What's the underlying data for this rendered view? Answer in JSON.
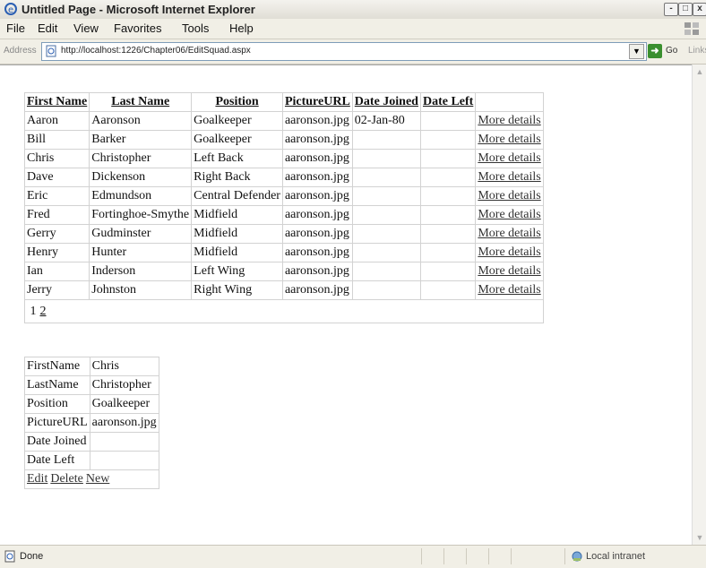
{
  "window": {
    "title": "Untitled Page - Microsoft Internet Explorer",
    "buttons": [
      "-",
      "□",
      "x"
    ]
  },
  "menu": [
    "File",
    "Edit",
    "View",
    "Favorites",
    "Tools",
    "Help"
  ],
  "address": {
    "label": "Address",
    "url": "http://localhost:1226/Chapter06/EditSquad.aspx",
    "go_label": "Go",
    "links_label": "Links"
  },
  "grid": {
    "headers": [
      "First Name",
      "Last Name",
      "Position",
      "PictureURL",
      "Date Joined",
      "Date Left",
      ""
    ],
    "rows": [
      {
        "first": "Aaron",
        "last": "Aaronson",
        "position": "Goalkeeper",
        "picture": "aaronson.jpg",
        "joined": "02-Jan-80",
        "left": "",
        "link": "More details"
      },
      {
        "first": "Bill",
        "last": "Barker",
        "position": "Goalkeeper",
        "picture": "aaronson.jpg",
        "joined": "",
        "left": "",
        "link": "More details"
      },
      {
        "first": "Chris",
        "last": "Christopher",
        "position": "Left Back",
        "picture": "aaronson.jpg",
        "joined": "",
        "left": "",
        "link": "More details"
      },
      {
        "first": "Dave",
        "last": "Dickenson",
        "position": "Right Back",
        "picture": "aaronson.jpg",
        "joined": "",
        "left": "",
        "link": "More details"
      },
      {
        "first": "Eric",
        "last": "Edmundson",
        "position": "Central Defender",
        "picture": "aaronson.jpg",
        "joined": "",
        "left": "",
        "link": "More details"
      },
      {
        "first": "Fred",
        "last": "Fortinghoe-Smythe",
        "position": "Midfield",
        "picture": "aaronson.jpg",
        "joined": "",
        "left": "",
        "link": "More details"
      },
      {
        "first": "Gerry",
        "last": "Gudminster",
        "position": "Midfield",
        "picture": "aaronson.jpg",
        "joined": "",
        "left": "",
        "link": "More details"
      },
      {
        "first": "Henry",
        "last": "Hunter",
        "position": "Midfield",
        "picture": "aaronson.jpg",
        "joined": "",
        "left": "",
        "link": "More details"
      },
      {
        "first": "Ian",
        "last": "Inderson",
        "position": "Left Wing",
        "picture": "aaronson.jpg",
        "joined": "",
        "left": "",
        "link": "More details"
      },
      {
        "first": "Jerry",
        "last": "Johnston",
        "position": "Right Wing",
        "picture": "aaronson.jpg",
        "joined": "",
        "left": "",
        "link": "More details"
      }
    ],
    "pager": {
      "current": "1",
      "next": "2"
    }
  },
  "detail": {
    "rows": [
      {
        "label": "FirstName",
        "value": "Chris"
      },
      {
        "label": "LastName",
        "value": "Christopher"
      },
      {
        "label": "Position",
        "value": "Goalkeeper"
      },
      {
        "label": "PictureURL",
        "value": "aaronson.jpg"
      },
      {
        "label": "Date Joined",
        "value": ""
      },
      {
        "label": "Date Left",
        "value": ""
      }
    ],
    "actions": [
      "Edit",
      "Delete",
      "New"
    ]
  },
  "status": {
    "text": "Done",
    "zone": "Local intranet"
  }
}
